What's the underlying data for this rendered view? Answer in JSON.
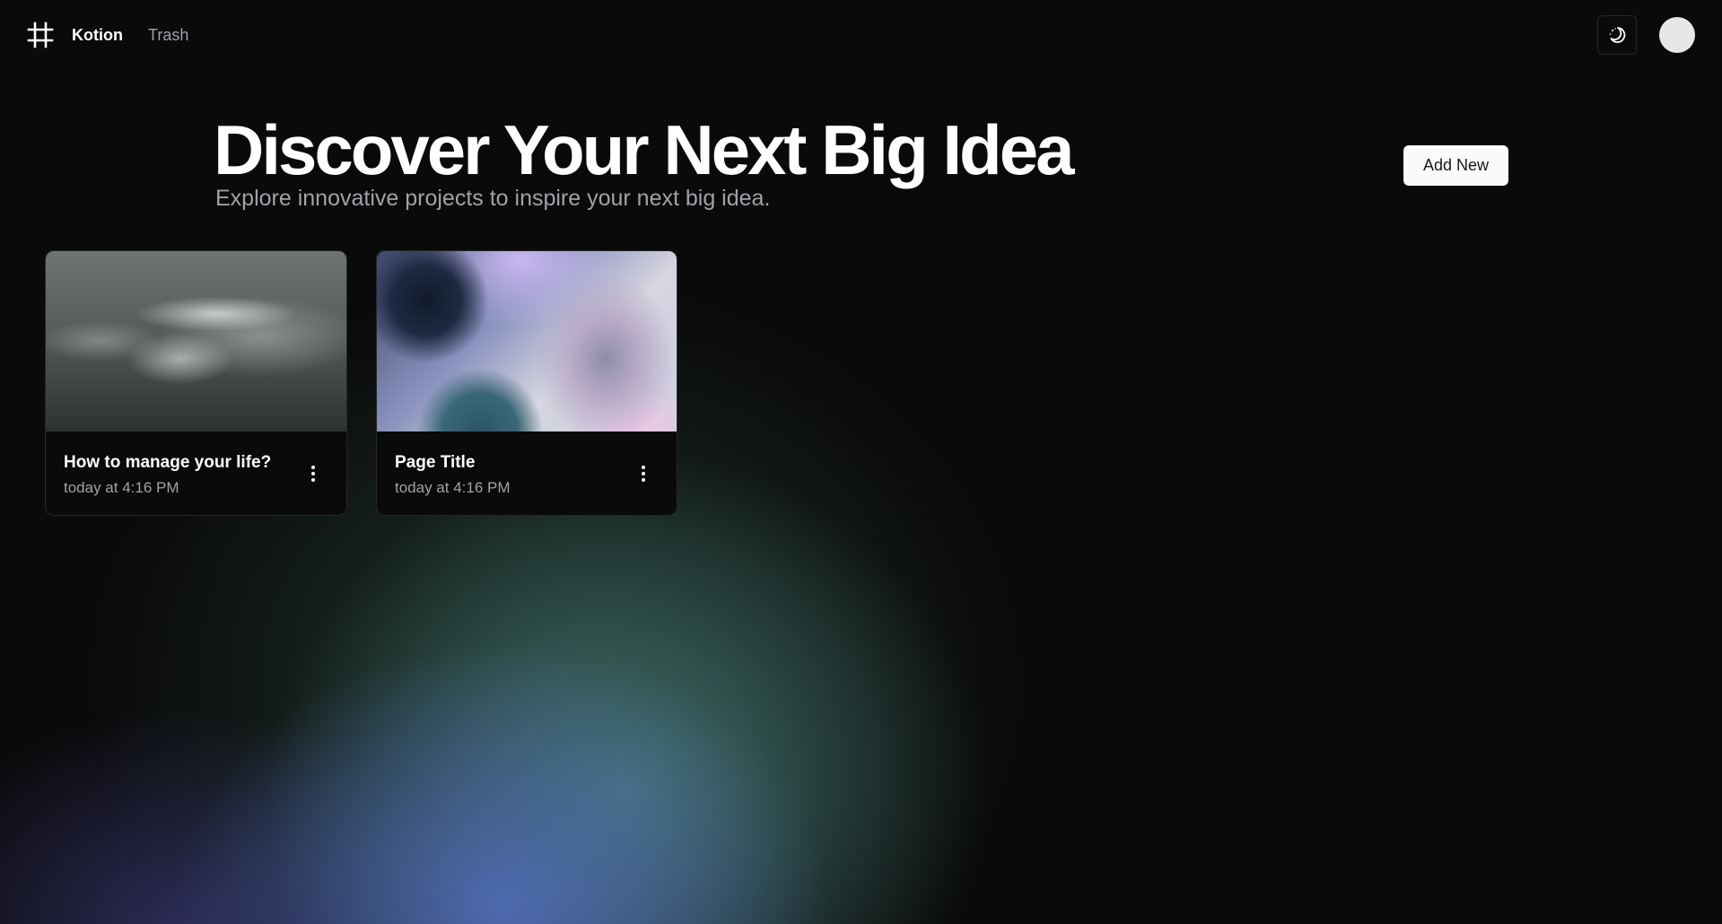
{
  "navbar": {
    "logo_icon": "hash-icon",
    "brand": "Kotion",
    "trash_link": "Trash",
    "theme_toggle_icon": "moon-stars-icon",
    "avatar": "user-avatar"
  },
  "hero": {
    "title": "Discover Your Next Big Idea",
    "subtitle": "Explore innovative projects to inspire your next big idea.",
    "add_button": "Add New"
  },
  "cards": [
    {
      "title": "How to manage your life?",
      "date": "today at 4:16 PM",
      "cover": "gray-smoke-particles",
      "menu_icon": "more-vertical-icon"
    },
    {
      "title": "Page Title",
      "date": "today at 4:16 PM",
      "cover": "pastel-abstract-shapes",
      "menu_icon": "more-vertical-icon"
    }
  ],
  "colors": {
    "background": "#0a0a0a",
    "text_primary": "#ffffff",
    "text_muted": "#a1a1aa",
    "button_bg": "#fafafa",
    "border": "#27272a",
    "glow_teal": "#4c8480",
    "glow_blue": "#5471c4"
  }
}
